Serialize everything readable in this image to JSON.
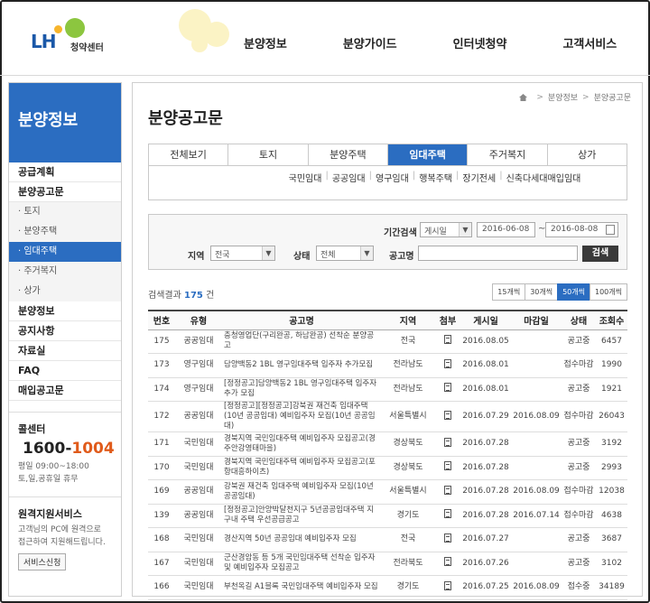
{
  "brand": {
    "logo_text": "LH",
    "logo_sub": "청약센터"
  },
  "gnb": [
    "분양정보",
    "분양가이드",
    "인터넷청약",
    "고객서비스"
  ],
  "sidebar": {
    "title": "분양정보",
    "items": [
      {
        "label": "공급계획",
        "type": "main"
      },
      {
        "label": "분양공고문",
        "type": "main"
      },
      {
        "label": "토지",
        "type": "sub"
      },
      {
        "label": "분양주택",
        "type": "sub"
      },
      {
        "label": "임대주택",
        "type": "sub",
        "active": true
      },
      {
        "label": "주거복지",
        "type": "sub"
      },
      {
        "label": "상가",
        "type": "sub"
      },
      {
        "label": "분양정보",
        "type": "main"
      },
      {
        "label": "공지사항",
        "type": "main"
      },
      {
        "label": "자료실",
        "type": "main"
      },
      {
        "label": "FAQ",
        "type": "main"
      },
      {
        "label": "매입공고문",
        "type": "main"
      }
    ],
    "call": {
      "title": "콜센터",
      "number_prefix": "1600-",
      "number_suffix": "1004",
      "hours_1": "평일 09:00~18:00",
      "hours_2": "토,일,공휴일 휴무"
    },
    "remote": {
      "title": "원격지원서비스",
      "desc_1": "고객님의 PC에 원격으로",
      "desc_2": "접근하여 지원해드립니다.",
      "button": "서비스신청"
    }
  },
  "breadcrumb": [
    "분양정보",
    "분양공고문"
  ],
  "page_title": "분양공고문",
  "tabs": [
    {
      "label": "전체보기"
    },
    {
      "label": "토지"
    },
    {
      "label": "분양주택"
    },
    {
      "label": "임대주택",
      "active": true
    },
    {
      "label": "주거복지"
    },
    {
      "label": "상가"
    }
  ],
  "subtabs": [
    "국민임대",
    "공공임대",
    "영구임대",
    "행복주택",
    "장기전세",
    "신축다세대매입임대"
  ],
  "search": {
    "period_label": "기간검색",
    "period_select": "게시일",
    "date_from": "2016-06-08",
    "date_sep": "~",
    "date_to": "2016-08-08",
    "region_label": "지역",
    "region_value": "전국",
    "status_label": "상태",
    "status_value": "전체",
    "name_label": "공고명",
    "name_value": "",
    "button": "검색"
  },
  "result": {
    "prefix": "검색결과",
    "count": "175",
    "suffix": "건"
  },
  "perpage": [
    {
      "label": "15개씩"
    },
    {
      "label": "30개씩"
    },
    {
      "label": "50개씩",
      "active": true
    },
    {
      "label": "100개씩"
    }
  ],
  "table": {
    "headers": [
      "번호",
      "유형",
      "공고명",
      "지역",
      "첨부",
      "게시일",
      "마감일",
      "상태",
      "조회수"
    ],
    "rows": [
      [
        "175",
        "공공임대",
        "충청영업단(구리완공, 하남완공) 선착순 분양공고",
        "전국",
        "",
        "2016.08.05",
        "",
        "공고중",
        "6457"
      ],
      [
        "173",
        "영구임대",
        "담양백동2 1BL 영구임대주택 입주자 추가모집",
        "전라남도",
        "",
        "2016.08.01",
        "",
        "접수마감",
        "1990"
      ],
      [
        "174",
        "영구임대",
        "[정정공고]담양백동2 1BL 영구임대주택 입주자 추가 모집",
        "전라남도",
        "",
        "2016.08.01",
        "",
        "공고중",
        "1921"
      ],
      [
        "172",
        "공공임대",
        "[정정공고][정정공고]강북권 재건축 임대주택 (10년 공공임대) 예비입주자 모집(10년 공공임대)",
        "서울특별시",
        "",
        "2016.07.29",
        "2016.08.09",
        "접수마감",
        "26043"
      ],
      [
        "171",
        "국민임대",
        "경북지역 국민임대주택 예비입주자 모집공고(경주안강영태마을)",
        "경상북도",
        "",
        "2016.07.28",
        "",
        "공고중",
        "3192"
      ],
      [
        "170",
        "국민임대",
        "경북지역 국민임대주택 예비입주자 모집공고(포항대흥하이츠)",
        "경상북도",
        "",
        "2016.07.28",
        "",
        "공고중",
        "2993"
      ],
      [
        "169",
        "공공임대",
        "강북권 재건축 임대주택 예비입주자 모집(10년 공공임대)",
        "서울특별시",
        "",
        "2016.07.28",
        "2016.08.09",
        "접수마감",
        "12038"
      ],
      [
        "139",
        "공공임대",
        "[정정공고]안양박달천지구 5년공공임대주택 지구내 주택 우선공급공고",
        "경기도",
        "",
        "2016.07.28",
        "2016.07.14",
        "접수마감",
        "4638"
      ],
      [
        "168",
        "국민임대",
        "경산지역 50년 공공임대 예비입주자 모집",
        "전국",
        "",
        "2016.07.27",
        "",
        "공고중",
        "3687"
      ],
      [
        "167",
        "국민임대",
        "군산경암동 등 5개 국민임대주택 선착순 입주자 및 예비입주자 모집공고",
        "전라북도",
        "",
        "2016.07.26",
        "",
        "공고중",
        "3102"
      ],
      [
        "166",
        "국민임대",
        "부천옥길 A1블록 국민임대주택 예비입주자 모집",
        "경기도",
        "",
        "2016.07.25",
        "2016.08.09",
        "접수중",
        "34189"
      ]
    ]
  }
}
